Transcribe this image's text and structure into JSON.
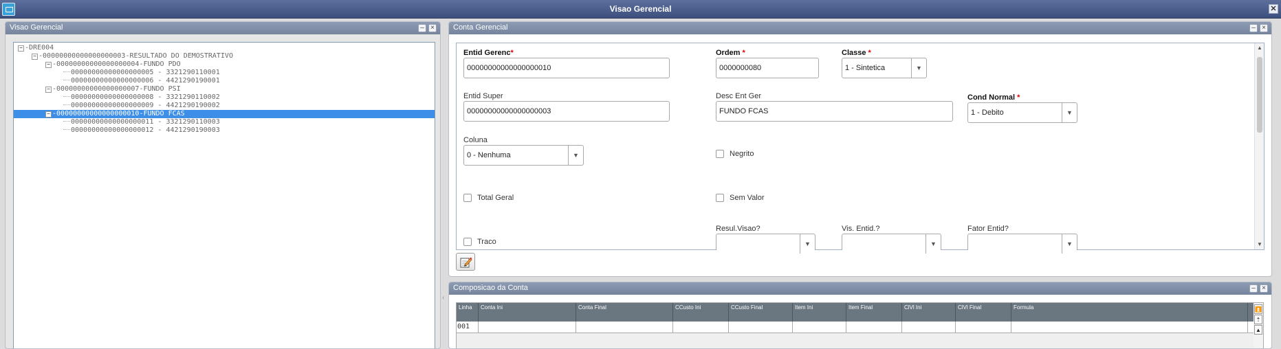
{
  "window": {
    "title": "Visao Gerencial",
    "close": "✕"
  },
  "left_panel": {
    "title": "Visao Gerencial",
    "tree": [
      {
        "text": "DRE004",
        "level": 0,
        "toggle": "−",
        "selected": false
      },
      {
        "text": "00000000000000000003-RESULTADO DO DEMOSTRATIVO",
        "level": 1,
        "toggle": "−",
        "selected": false
      },
      {
        "text": "00000000000000000004-FUNDO PDO",
        "level": 2,
        "toggle": "−",
        "selected": false
      },
      {
        "text": "00000000000000000005 - 3321290110001",
        "level": 3,
        "toggle": "",
        "selected": false
      },
      {
        "text": "00000000000000000006 - 4421290190001",
        "level": 3,
        "toggle": "",
        "selected": false
      },
      {
        "text": "00000000000000000007-FUNDO PSI",
        "level": 2,
        "toggle": "−",
        "selected": false
      },
      {
        "text": "00000000000000000008 - 3321290110002",
        "level": 3,
        "toggle": "",
        "selected": false
      },
      {
        "text": "00000000000000000009 - 4421290190002",
        "level": 3,
        "toggle": "",
        "selected": false
      },
      {
        "text": "00000000000000000010-FUNDO FCAS",
        "level": 2,
        "toggle": "−",
        "selected": true
      },
      {
        "text": "00000000000000000011 - 3321290110003",
        "level": 3,
        "toggle": "",
        "selected": false
      },
      {
        "text": "00000000000000000012 - 4421290190003",
        "level": 3,
        "toggle": "",
        "selected": false
      }
    ]
  },
  "conta_gerencial": {
    "title": "Conta Gerencial",
    "required_mark": "*",
    "entid_gerenc": {
      "label": "Entid Gerenc",
      "value": "00000000000000000010"
    },
    "ordem": {
      "label": "Ordem",
      "value": "0000000080"
    },
    "classe": {
      "label": "Classe",
      "value": "1 - Sintetica"
    },
    "entid_super": {
      "label": "Entid Super",
      "value": "00000000000000000003"
    },
    "desc_ent_ger": {
      "label": "Desc Ent Ger",
      "value": "FUNDO FCAS"
    },
    "cond_normal": {
      "label": "Cond Normal",
      "value": "1 - Debito"
    },
    "coluna": {
      "label": "Coluna",
      "value": "0 - Nenhuma"
    },
    "negrito": {
      "label": "Negrito",
      "checked": false
    },
    "total_geral": {
      "label": "Total Geral",
      "checked": false
    },
    "sem_valor": {
      "label": "Sem Valor",
      "checked": false
    },
    "traco": {
      "label": "Traco",
      "checked": false
    },
    "resul_visao": {
      "label": "Resul.Visao?",
      "value": ""
    },
    "vis_entid": {
      "label": "Vis. Entid.?",
      "value": ""
    },
    "fator_entid": {
      "label": "Fator Entid?",
      "value": ""
    }
  },
  "composicao": {
    "title": "Composicao da Conta",
    "columns": [
      "Linha",
      "Conta Ini",
      "Conta Final",
      "CCusto Ini",
      "CCusto Final",
      "Item Ini",
      "Item Final",
      "ClVl Ini",
      "ClVl Final",
      "Formula"
    ],
    "rows": [
      [
        "001",
        "",
        "",
        "",
        "",
        "",
        "",
        "",
        "",
        ""
      ]
    ]
  },
  "colors": {
    "selection": "#3d8ee6",
    "titlebar": "#4a5c8a",
    "panel_header": "#7f8ca5",
    "required": "#dd0000"
  },
  "icons": [
    "app-icon",
    "close-icon",
    "minimize-icon",
    "edit-icon",
    "chevron-down-icon"
  ]
}
